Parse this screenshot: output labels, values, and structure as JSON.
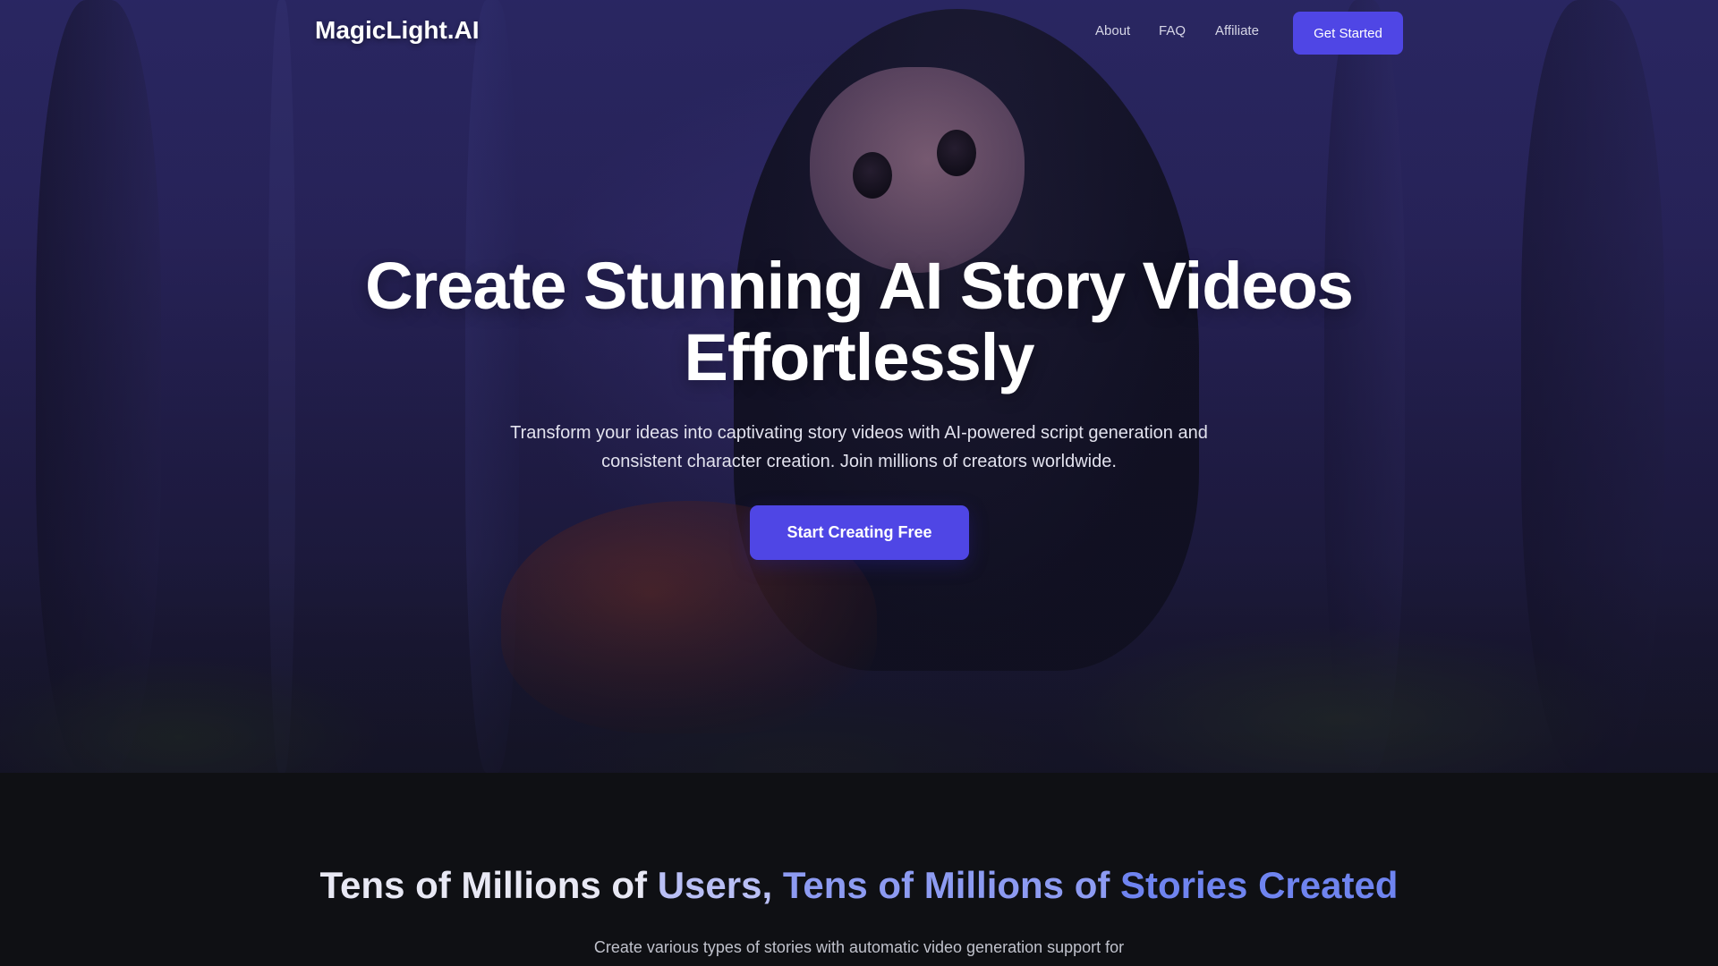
{
  "nav": {
    "logo": "MagicLight.AI",
    "links": [
      "About",
      "FAQ",
      "Affiliate"
    ],
    "cta": "Get Started"
  },
  "hero": {
    "title_line1": "Create Stunning AI Story Videos",
    "title_line2": "Effortlessly",
    "subtitle_line1": "Transform your ideas into captivating story videos with AI-powered script generation and",
    "subtitle_line2": "consistent character creation. Join millions of creators worldwide.",
    "cta": "Start Creating Free"
  },
  "stats_section": {
    "title_part1": "Tens of Millions of",
    "title_part2": "Users,",
    "title_part3": "Tens of Millions of",
    "title_part4": "Stories Created",
    "subtitle": "Create various types of stories with automatic video generation support for"
  },
  "colors": {
    "accent": "#4f46e5",
    "page_background": "#0f1014"
  }
}
